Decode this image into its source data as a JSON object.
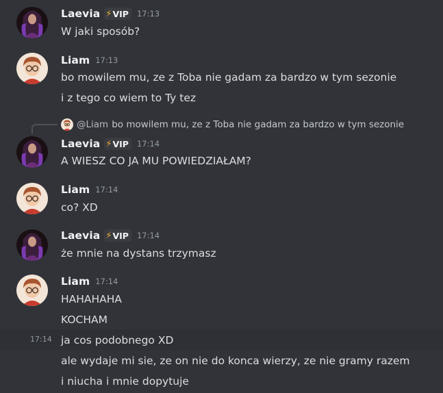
{
  "messages": [
    {
      "author": "Laevia",
      "badge": "VIP",
      "time": "17:13",
      "lines": [
        "W jaki sposób?"
      ]
    },
    {
      "author": "Liam",
      "time": "17:13",
      "lines": [
        "bo mowilem mu, ze z Toba nie gadam za bardzo w tym sezonie",
        "i z tego co wiem to Ty tez"
      ]
    },
    {
      "reply": {
        "mention": "@Liam",
        "text": "bo mowilem mu, ze z Toba nie gadam za bardzo w tym sezonie"
      },
      "author": "Laevia",
      "badge": "VIP",
      "time": "17:14",
      "lines": [
        "A WIESZ CO JA MU POWIEDZIAŁAM?"
      ]
    },
    {
      "author": "Liam",
      "time": "17:14",
      "lines": [
        "co? XD"
      ]
    },
    {
      "author": "Laevia",
      "badge": "VIP",
      "time": "17:14",
      "lines": [
        "że mnie na dystans trzymasz"
      ]
    },
    {
      "author": "Liam",
      "time": "17:14",
      "lines": [
        "HAHAHAHA",
        "KOCHAM",
        "ja cos podobnego XD",
        "ale wydaje mi sie, ze on nie do konca wierzy, ze nie gramy razem",
        "i niucha i mnie dopytuje"
      ],
      "hover_time": "17:14"
    }
  ],
  "colors": {
    "background": "#313338",
    "username": "#f2f3f5",
    "text": "#dbdee1",
    "muted": "#949ba4",
    "bolt": "#f0b232"
  },
  "icons": {
    "badge_icon": "lightning-bolt-icon"
  }
}
